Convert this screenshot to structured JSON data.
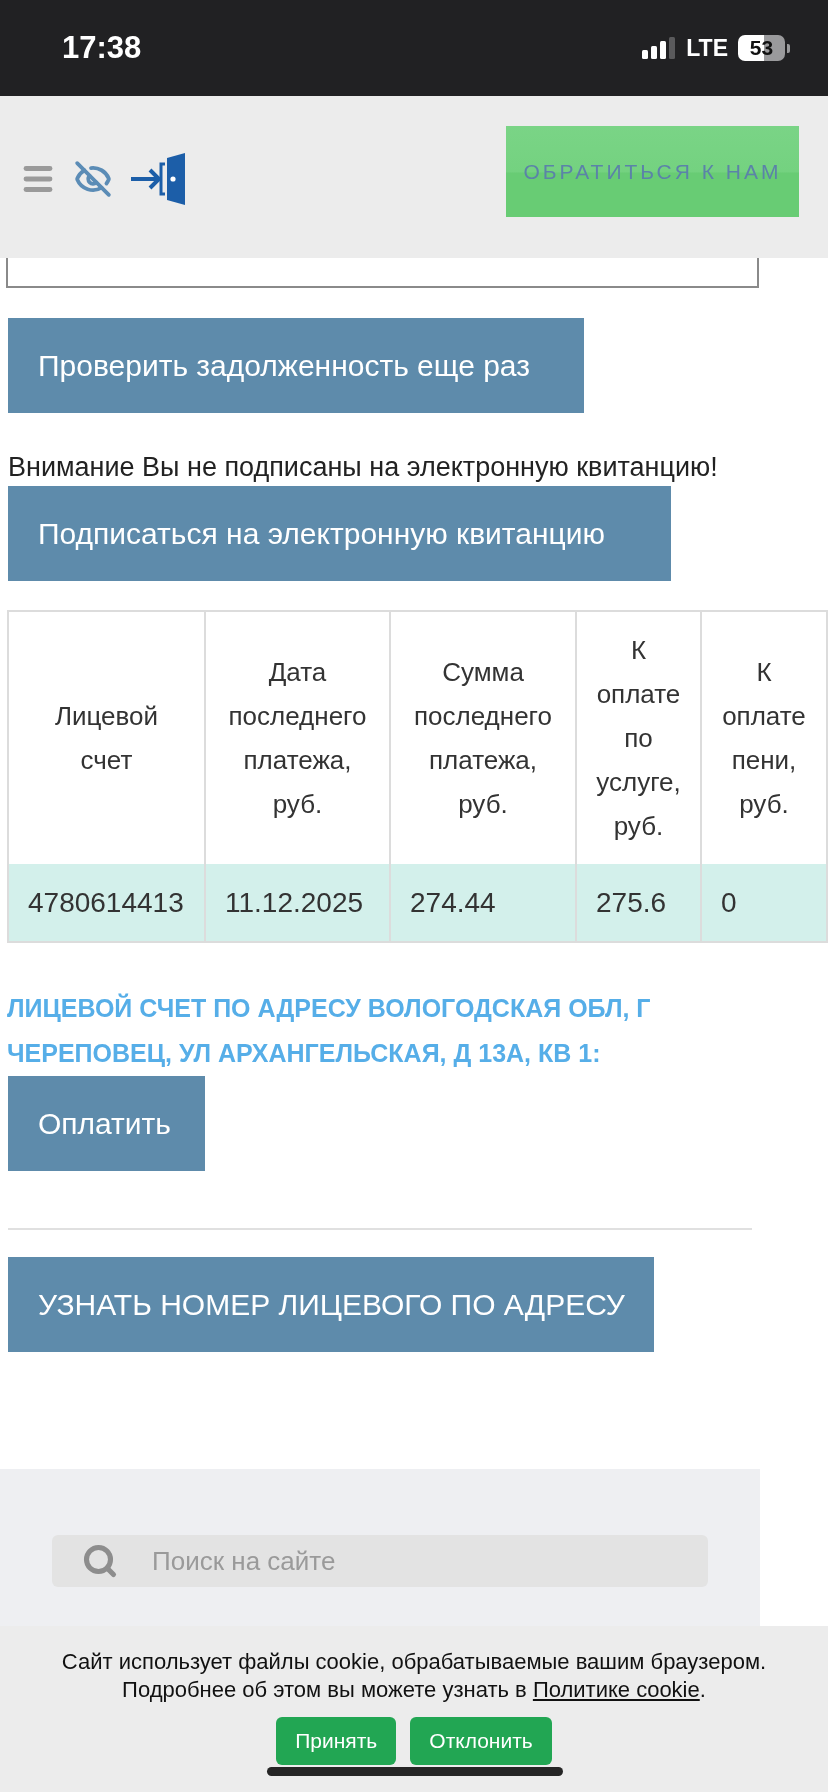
{
  "status_bar": {
    "time": "17:38",
    "network": "LTE",
    "battery": "53"
  },
  "header": {
    "contact_button": "ОБРАТИТЬСЯ К НАМ"
  },
  "actions": {
    "check_debt_button": "Проверить задолженность еще раз",
    "notice": "Внимание Вы не подписаны на электронную квитанцию!",
    "subscribe_button": "Подписаться на электронную квитанцию"
  },
  "table": {
    "columns": [
      "Лицевой счет",
      "Дата последнего платежа, руб.",
      "Сумма последнего платежа, руб.",
      "К оплате по услуге, руб.",
      "К оплате пени, руб."
    ],
    "rows": [
      [
        "4780614413",
        "11.12.2025",
        "274.44",
        "275.6",
        "0"
      ]
    ]
  },
  "account_heading": "ЛИЦЕВОЙ СЧЕТ ПО АДРЕСУ ВОЛОГОДСКАЯ ОБЛ, Г ЧЕРЕПОВЕЦ, УЛ АРХАНГЕЛЬСКАЯ, Д 13А, КВ 1:",
  "pay_button": "Оплатить",
  "find_account_button": "УЗНАТЬ НОМЕР ЛИЦЕВОГО ПО АДРЕСУ",
  "footer": {
    "search": {
      "placeholder": "Поиск на сайте"
    }
  },
  "cookie_banner": {
    "message": "Сайт использует файлы cookie, обрабатываемые вашим браузером.",
    "details": "Подробнее об этом вы можете узнать в ",
    "link": "Политике cookie",
    "details_end": ".",
    "buttons": [
      "Принять",
      "Отклонить"
    ]
  }
}
